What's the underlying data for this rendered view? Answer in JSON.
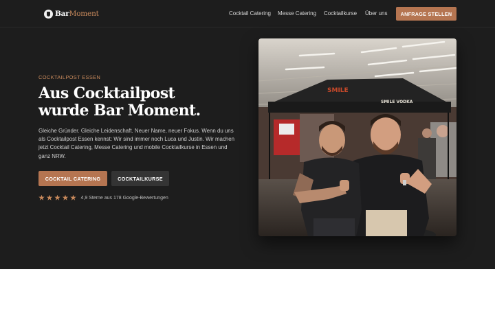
{
  "brand": {
    "name_part1": "Bar",
    "name_part2": "Moment",
    "accent_color": "#c98a5c",
    "button_color": "#b57551",
    "background_color": "#1d1d1d"
  },
  "nav": {
    "links": [
      "Cocktail Catering",
      "Messe Catering",
      "Cocktailkurse",
      "Über uns"
    ],
    "cta_label": "ANFRAGE STELLEN"
  },
  "hero": {
    "eyebrow": "COCKTAILPOST ESSEN",
    "headline_line1": "Aus Cocktailpost",
    "headline_line2": "wurde Bar Moment.",
    "lead": "Gleiche Gründer. Gleiche Leidenschaft. Neuer Name, neuer Fokus. Wenn du uns als Cocktailpost Essen kennst: Wir sind immer noch Luca und Justin. Wir machen jetzt Cocktail Catering, Messe Catering und mobile Cocktailkurse in Essen und ganz NRW.",
    "primary_button": "COCKTAIL CATERING",
    "secondary_button": "COCKTAILKURSE",
    "rating_stars": 5,
    "rating_text": "4,9 Sterne aus 178 Google-Bewertungen"
  },
  "photo": {
    "banner_left": "SMILE",
    "banner_right": "SMILE VODKA"
  }
}
